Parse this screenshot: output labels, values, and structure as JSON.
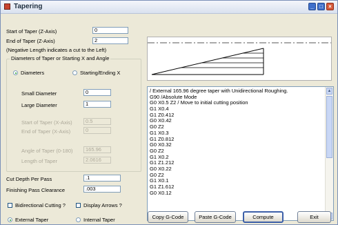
{
  "window": {
    "title": "Tapering"
  },
  "taper_start": {
    "label": "Start of Taper (Z-Axis)",
    "value": "0"
  },
  "taper_end": {
    "label": "End of Taper (Z-Axis)",
    "value": "2"
  },
  "negative_note": "(Negative Length indicates a cut to the Left)",
  "diam_group": {
    "title": "Diameters of Taper or Starting X and Angle",
    "radio_diameters": "Diameters",
    "radio_starting": "Starting/Ending X",
    "small_label": "Small Diameter",
    "small_value": "0",
    "large_label": "Large Diameter",
    "large_value": "1",
    "start_x_label": "Start of Taper (X-Axis)",
    "start_x_value": "0.5",
    "end_x_label": "End of Taper (X-Axis)",
    "end_x_value": "0",
    "angle_label": "Angle of Taper (0-180)",
    "angle_value": "165.96",
    "length_label": "Length of Taper",
    "length_value": "2.0616"
  },
  "cut_depth": {
    "label": "Cut Depth Per Pass",
    "value": ".1"
  },
  "finish_clearance": {
    "label": "Finishing Pass Clearance",
    "value": ".003"
  },
  "options": {
    "bidirectional": "Bidirectional Cutting ?",
    "display_arrows": "Display Arrows ?"
  },
  "taper_type": {
    "external": "External Taper",
    "internal": "Internal Taper"
  },
  "gcode_lines": [
    "/ External 165.96 degree taper with Unidirectional Roughing.",
    "G90   /Absolute Mode",
    "G0 X0.5 Z2  / Move to initial cutting position",
    "G1 X0.4",
    "G1 Z0.412",
    "G0 X0.42",
    "G0 Z2",
    "G1 X0.3",
    "G1 Z0.812",
    "G0 X0.32",
    "G0 Z2",
    "G1 X0.2",
    "G1 Z1.212",
    "G0 X0.22",
    "G0 Z2",
    "G1 X0.1",
    "G1 Z1.612",
    "G0 X0.12"
  ],
  "buttons": {
    "copy": "Copy G-Code",
    "paste": "Paste G-Code",
    "compute": "Compute",
    "exit": "Exit"
  },
  "colors": {
    "title_bar": "#dfe6f2",
    "window_bg": "#ece9d8",
    "close_button": "#d5593a",
    "minmax_button": "#3f6fcb"
  }
}
